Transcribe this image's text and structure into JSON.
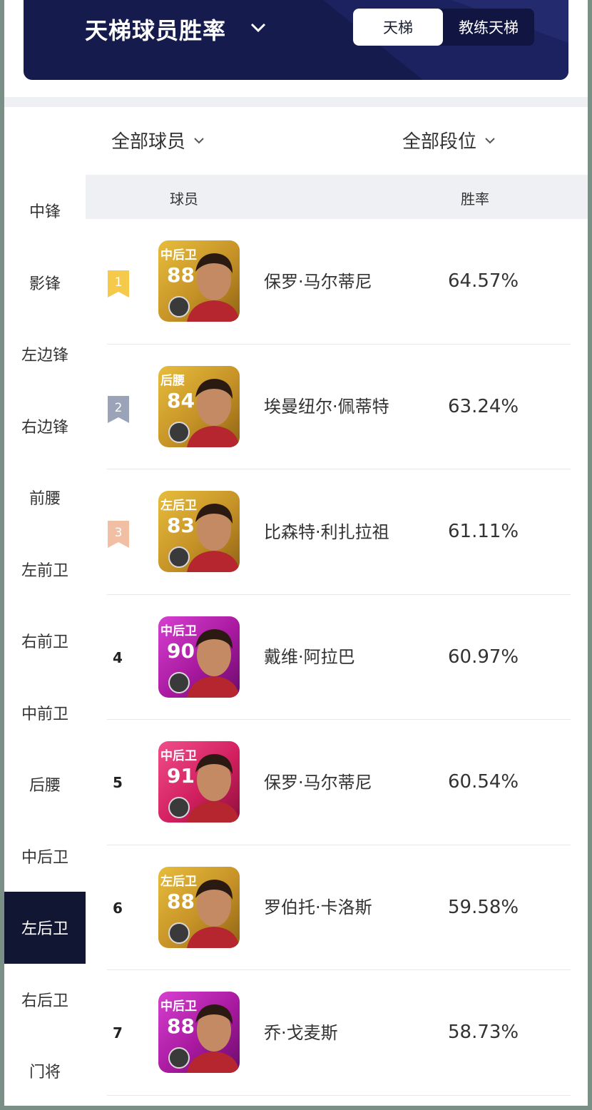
{
  "header": {
    "title": "天梯球员胜率",
    "tabs": [
      {
        "label": "天梯",
        "active": true
      },
      {
        "label": "教练天梯",
        "active": false
      }
    ]
  },
  "filters": {
    "players": "全部球员",
    "ranks": "全部段位"
  },
  "sidebar": {
    "items": [
      "中锋",
      "影锋",
      "左边锋",
      "右边锋",
      "前腰",
      "左前卫",
      "右前卫",
      "中前卫",
      "后腰",
      "中后卫",
      "左后卫",
      "右后卫",
      "门将"
    ],
    "active": "左后卫"
  },
  "table": {
    "columns": {
      "player": "球员",
      "winrate": "胜率"
    },
    "rows": [
      {
        "rank": "1",
        "position": "中后卫",
        "rating": "88",
        "name": "保罗·马尔蒂尼",
        "winrate": "64.57%",
        "card_color": "gold",
        "badge_color": "#f5c94a"
      },
      {
        "rank": "2",
        "position": "后腰",
        "rating": "84",
        "name": "埃曼纽尔·佩蒂特",
        "winrate": "63.24%",
        "card_color": "gold",
        "badge_color": "#9aa3b8"
      },
      {
        "rank": "3",
        "position": "左后卫",
        "rating": "83",
        "name": "比森特·利扎拉祖",
        "winrate": "61.11%",
        "card_color": "gold",
        "badge_color": "#f0bfa4"
      },
      {
        "rank": "4",
        "position": "中后卫",
        "rating": "90",
        "name": "戴维·阿拉巴",
        "winrate": "60.97%",
        "card_color": "purple",
        "badge_color": ""
      },
      {
        "rank": "5",
        "position": "中后卫",
        "rating": "91",
        "name": "保罗·马尔蒂尼",
        "winrate": "60.54%",
        "card_color": "pink",
        "badge_color": ""
      },
      {
        "rank": "6",
        "position": "左后卫",
        "rating": "88",
        "name": "罗伯托·卡洛斯",
        "winrate": "59.58%",
        "card_color": "gold",
        "badge_color": ""
      },
      {
        "rank": "7",
        "position": "中后卫",
        "rating": "88",
        "name": "乔·戈麦斯",
        "winrate": "58.73%",
        "card_color": "purple",
        "badge_color": ""
      }
    ]
  },
  "colors": {
    "banner": "#161b4e",
    "sidebar_active": "#111733",
    "gold_card": "#c99a2a",
    "purple_card": "#b02bb0",
    "pink_card": "#d82a6a"
  }
}
